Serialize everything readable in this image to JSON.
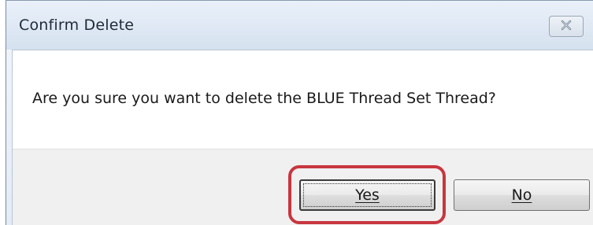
{
  "dialog": {
    "title": "Confirm Delete",
    "message": "Are you sure you want to delete the BLUE Thread Set Thread?",
    "close_icon": "close-icon",
    "buttons": {
      "yes_label": "Yes",
      "no_label": "No"
    },
    "annotation": {
      "highlight_color": "#c7363f",
      "highlighted_button": "Yes"
    }
  }
}
